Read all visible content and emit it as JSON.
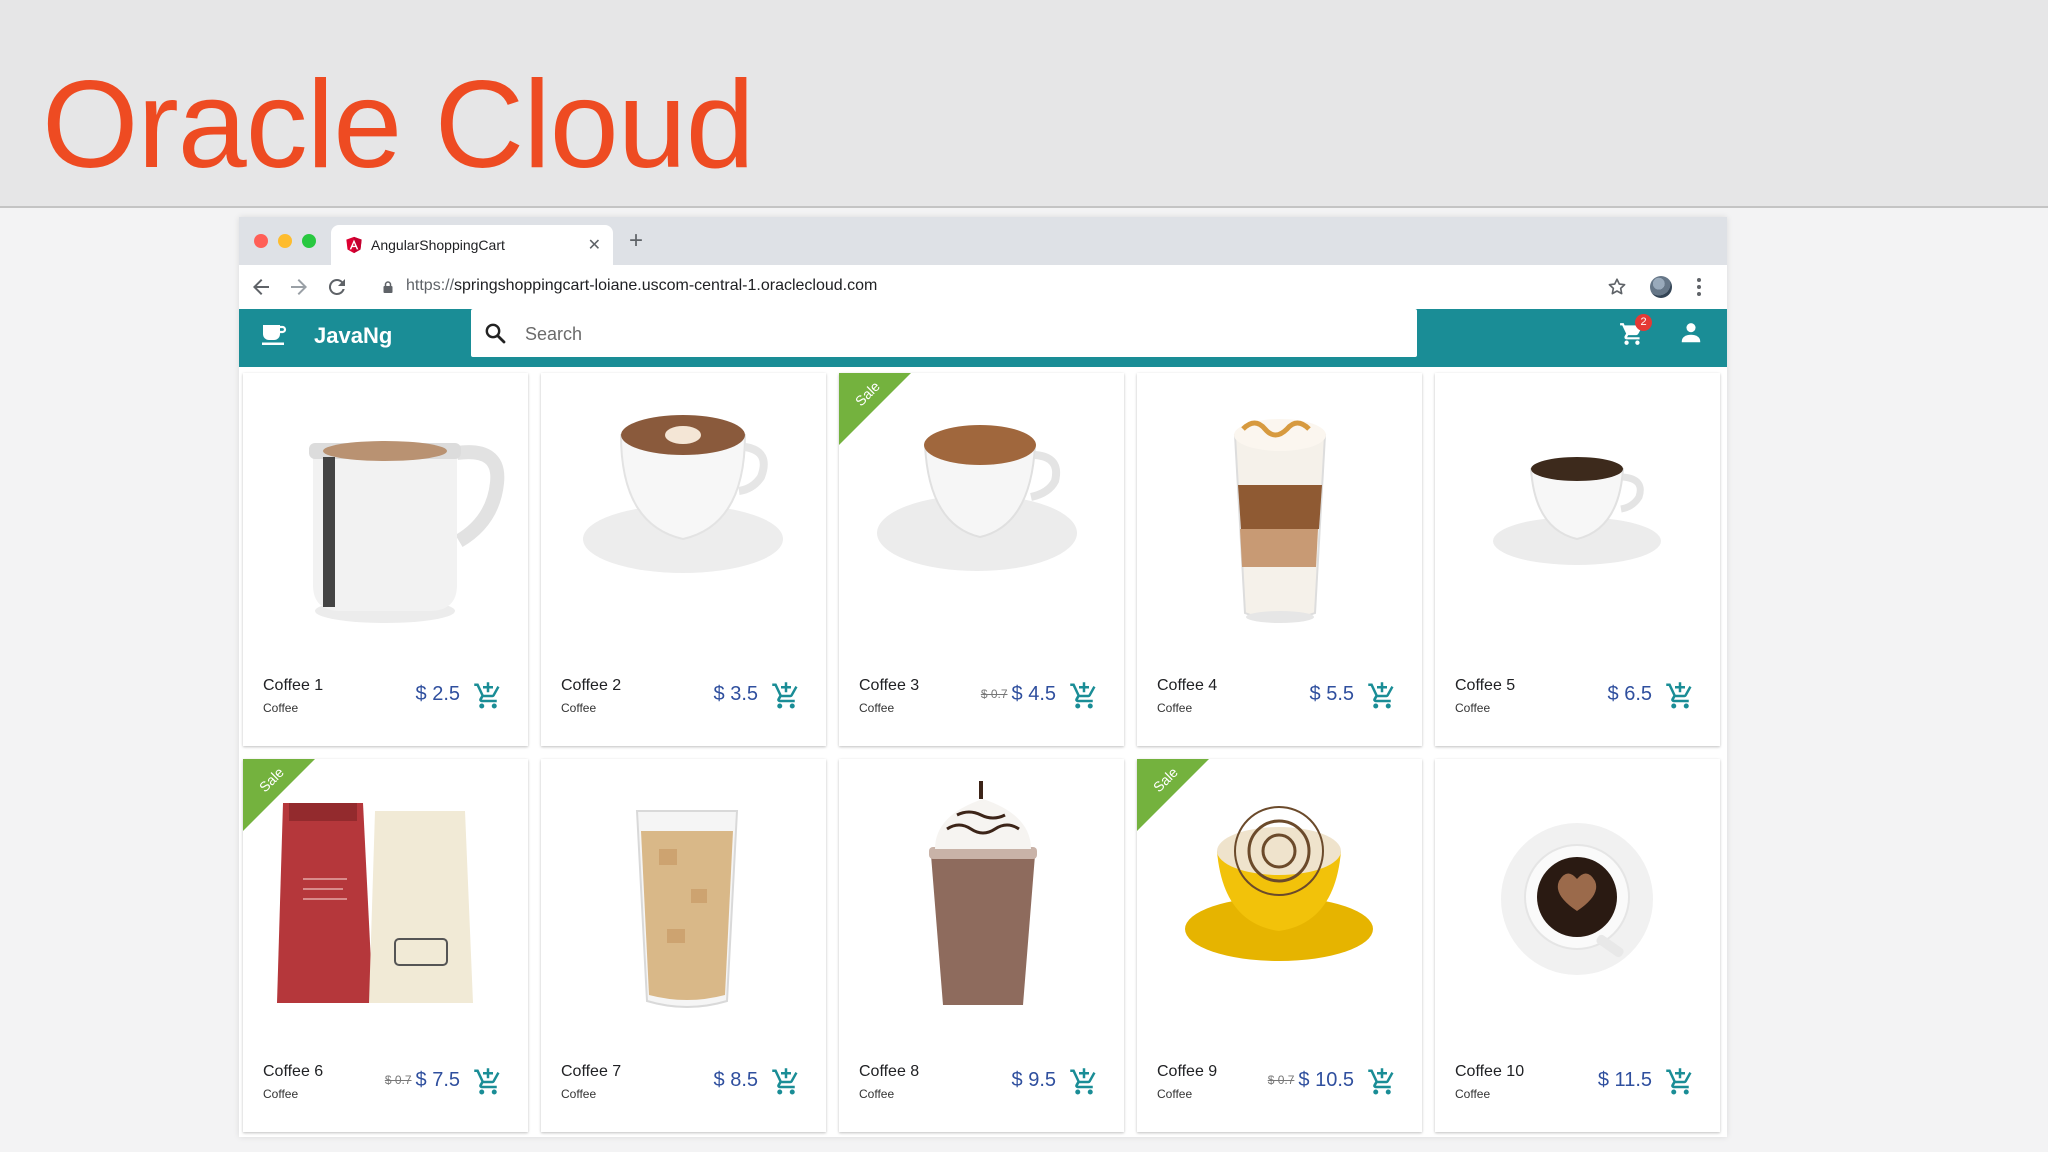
{
  "slide": {
    "title": "Oracle Cloud"
  },
  "browser": {
    "tab_title": "AngularShoppingCart",
    "url_scheme": "https://",
    "url_host": "springshoppingcart-loiane.uscom-central-1.oraclecloud.com"
  },
  "app": {
    "brand": "JavaNg",
    "search_placeholder": "Search",
    "cart_count": "2",
    "accent_color": "#1a8d96"
  },
  "products": [
    {
      "name": "Coffee 1",
      "category": "Coffee",
      "price": "$ 2.5",
      "old_price": "",
      "sale": false,
      "image": "white-mug"
    },
    {
      "name": "Coffee 2",
      "category": "Coffee",
      "price": "$ 3.5",
      "old_price": "",
      "sale": false,
      "image": "latte-art-cup"
    },
    {
      "name": "Coffee 3",
      "category": "Coffee",
      "price": "$ 4.5",
      "old_price": "$ 0.7",
      "sale": true,
      "sale_label": "Sale",
      "image": "espresso-cup"
    },
    {
      "name": "Coffee 4",
      "category": "Coffee",
      "price": "$ 5.5",
      "old_price": "",
      "sale": false,
      "image": "caramel-macchiato-glass"
    },
    {
      "name": "Coffee 5",
      "category": "Coffee",
      "price": "$ 6.5",
      "old_price": "",
      "sale": false,
      "image": "small-cup"
    },
    {
      "name": "Coffee 6",
      "category": "Coffee",
      "price": "$ 7.5",
      "old_price": "$ 0.7",
      "sale": true,
      "sale_label": "Sale",
      "image": "coffee-bags"
    },
    {
      "name": "Coffee 7",
      "category": "Coffee",
      "price": "$ 8.5",
      "old_price": "",
      "sale": false,
      "image": "iced-coffee-glass"
    },
    {
      "name": "Coffee 8",
      "category": "Coffee",
      "price": "$ 9.5",
      "old_price": "",
      "sale": false,
      "image": "frappe-cup"
    },
    {
      "name": "Coffee 9",
      "category": "Coffee",
      "price": "$ 10.5",
      "old_price": "$ 0.7",
      "sale": true,
      "sale_label": "Sale",
      "image": "yellow-cup"
    },
    {
      "name": "Coffee 10",
      "category": "Coffee",
      "price": "$ 11.5",
      "old_price": "",
      "sale": false,
      "image": "black-coffee-top"
    }
  ]
}
